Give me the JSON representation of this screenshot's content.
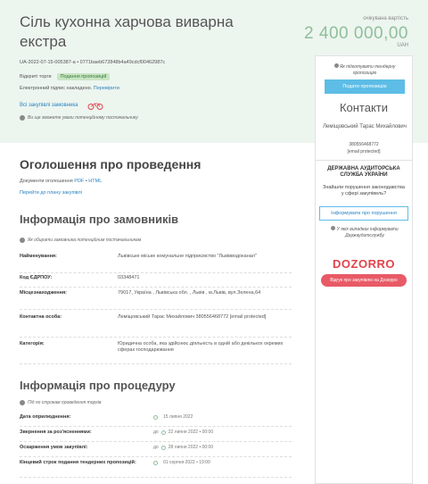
{
  "header": {
    "title": "Сіль кухонна харчова виварна екстра",
    "expected_label": "очікувана вартість",
    "amount": "2 400 000,00",
    "currency": "UAH",
    "tender_id": "UA-2022-07-15-005387-a • 0771baeb672848b4a49cdcf00462987c",
    "status_label": "Відкриті торги",
    "status_badge": "Подання пропозицій",
    "signature_text": "Електронний підпис накладено.",
    "signature_link": "Перевірити",
    "all_tenders_link": "Всі закупівлі замовника",
    "notice": "Ви ще зможете уваги потенційному постачальнику"
  },
  "panel": {
    "tender_note": "Як підготувати тендерну пропозицію",
    "submit_button": "Подати пропозицію",
    "contacts_title": "Контакти",
    "contact_name": "Леміщовський Тарас Михайлович",
    "contact_phone": "380556468772",
    "contact_email": "[email protected]",
    "agency_title": "ДЕРЖАВНА АУДИТОРСЬКА СЛУЖБА УКРАЇНИ",
    "agency_question": "Знайшли порушення законодавства у сфері закупівель?",
    "report_button": "Інформувати про порушення",
    "agency_note": "У якіх випадках інформувати Держаудитслужбу",
    "logo": "DOZORRO",
    "review_button": "Відгук про закупівлю на Дозорро"
  },
  "announcement": {
    "title": "Оголошення про проведення",
    "docs_label": "Документи оголошення",
    "docs_pdf": "PDF",
    "docs_sep": "•",
    "docs_html": "HTML",
    "plan_link": "Перейти до плану закупівлі"
  },
  "customer": {
    "title": "Інформація про замовників",
    "note": "Як обирати замовника потенційним постачальникам",
    "rows": [
      {
        "key": "Найменування:",
        "value": "Львівське міське комунальне підприємство \"Львівводоканал\""
      },
      {
        "key": "Код ЄДРПОУ:",
        "value": "03348471"
      },
      {
        "key": "Місцезнаходження:",
        "value": "79017, Україна , Львівська обл. , Львів , м.Львів, вул.Зелена,64"
      },
      {
        "key": "Контактна особа:",
        "value": "Леміщовський Тарас Михайлович 380556468772 [email protected]"
      },
      {
        "key": "Категорія:",
        "value": "Юридична особа, яка здійснює діяльність в одній або декількох окремих сферах господарювання"
      }
    ]
  },
  "procedure": {
    "title": "Інформація про процедуру",
    "note": "Під по строкам проведення торгів",
    "rows": [
      {
        "key": "Дата оприлюднення:",
        "prefix": "",
        "value": "15 липня 2022"
      },
      {
        "key": "Звернення за роз'ясненнями:",
        "prefix": "до",
        "value": "22 липня 2022  •  00:00"
      },
      {
        "key": "Оскарження умов закупівлі:",
        "prefix": "до",
        "value": "28 липня 2022  •  00:00"
      },
      {
        "key": "Кінцевий строк подання тендерних пропозицій:",
        "prefix": "",
        "value": "01 серпня 2022  •  19:00"
      }
    ]
  },
  "colors": {
    "hero_bg": "#edf5ef",
    "amount": "#8fbf9b",
    "link": "#2a83c2",
    "primary_button": "#5dbde6",
    "dozorro": "#e0434a"
  }
}
